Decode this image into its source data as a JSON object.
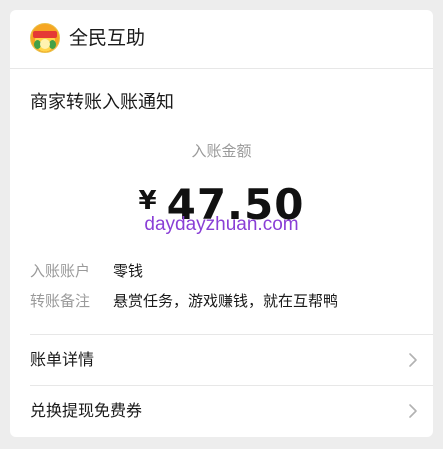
{
  "header": {
    "app_name": "全民互助"
  },
  "notice": {
    "title": "商家转账入账通知",
    "amount_label": "入账金额",
    "currency_symbol": "¥",
    "amount": "47.50",
    "watermark": "daydayzhuan.com"
  },
  "details": [
    {
      "label": "入账账户",
      "value": "零钱"
    },
    {
      "label": "转账备注",
      "value": "悬赏任务，游戏赚钱，就在互帮鸭"
    }
  ],
  "links": [
    {
      "label": "账单详情"
    },
    {
      "label": "兑换提现免费券"
    }
  ],
  "colors": {
    "background": "#ededed",
    "card": "#ffffff",
    "secondary_text": "#9a9a9a",
    "watermark": "#8a3fd6"
  }
}
